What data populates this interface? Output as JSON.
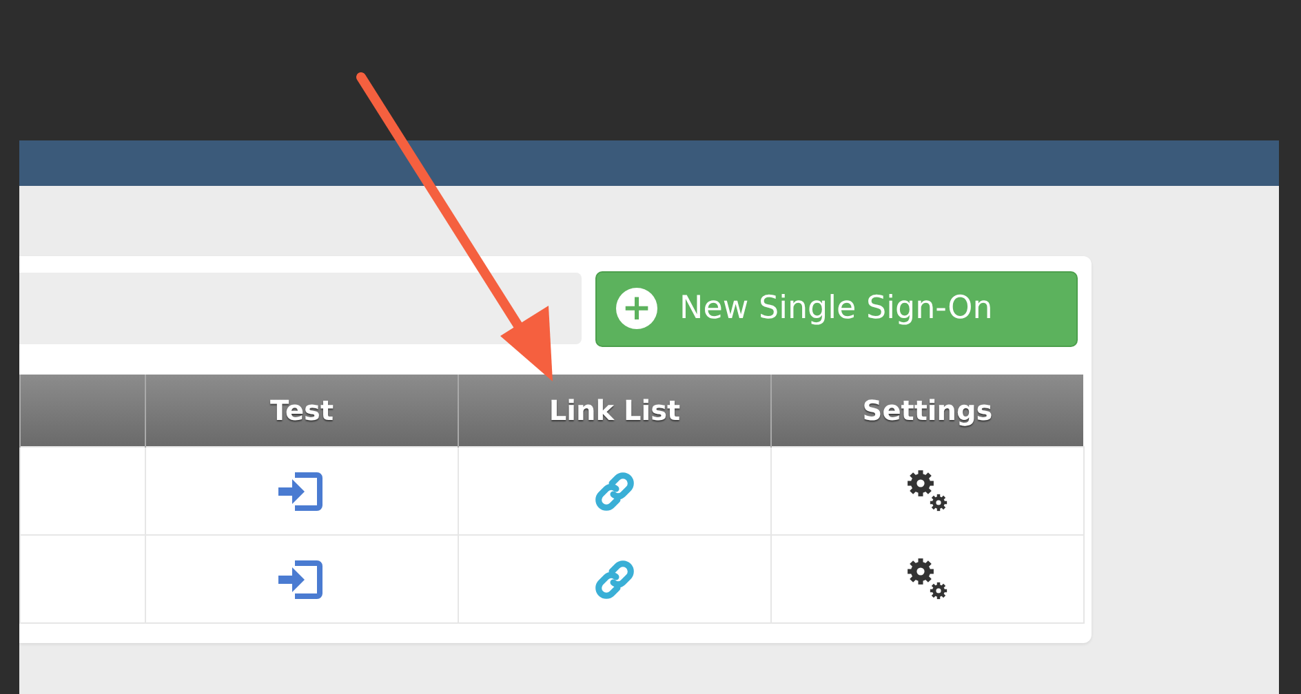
{
  "toolbar": {
    "new_button": {
      "label": "New Single Sign-On",
      "icon": "+"
    }
  },
  "table": {
    "columns": [
      "Test",
      "Link List",
      "Settings"
    ],
    "rows": [
      {
        "selected": false
      },
      {
        "selected": false
      }
    ]
  },
  "annotation": {
    "kind": "arrow"
  }
}
